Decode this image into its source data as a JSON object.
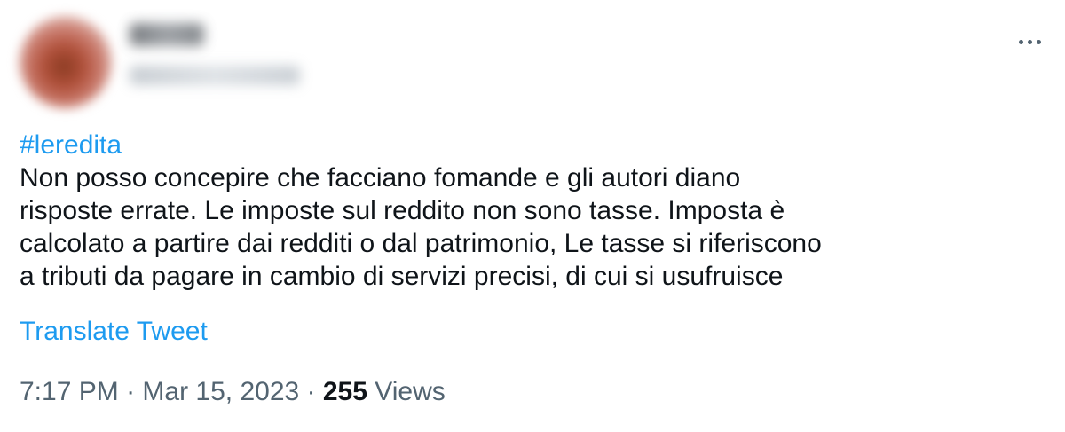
{
  "tweet": {
    "hashtag": "#leredita",
    "lines": [
      "Non posso concepire che facciano fomande e gli autori diano",
      "risposte errate. Le imposte sul reddito non sono tasse. Imposta è",
      "calcolato a partire dai redditi o dal patrimonio, Le tasse si riferiscono",
      "a tributi da pagare in cambio di servizi precisi, di cui si usufruisce"
    ],
    "translate_label": "Translate Tweet",
    "time": "7:17 PM",
    "separator": " · ",
    "date": "Mar 15, 2023",
    "views_count": "255",
    "views_label": " Views"
  },
  "icons": {
    "more": "more-horizontal-icon"
  },
  "colors": {
    "link": "#1d9bf0",
    "text": "#0f1419",
    "secondary": "#536471"
  }
}
